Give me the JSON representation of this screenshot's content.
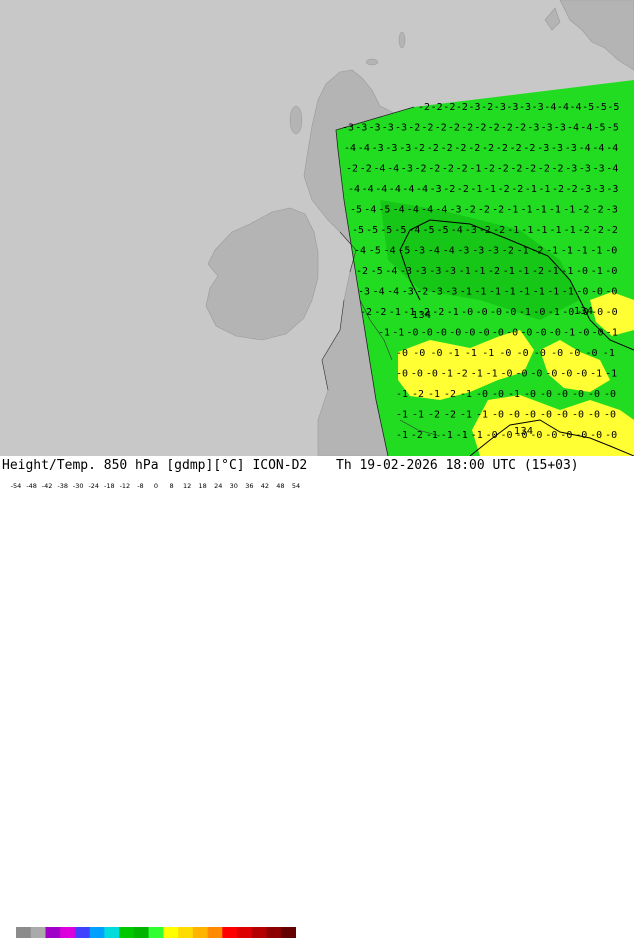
{
  "footer": {
    "product": "Height/Temp. 850 hPa [gdmp][°C] ICON-D2",
    "datetime": "Th 19-02-2026 18:00 UTC (15+03)"
  },
  "legend": {
    "ticks": [
      "-54",
      "-48",
      "-42",
      "-38",
      "-30",
      "-24",
      "-18",
      "-12",
      "-8",
      "0",
      "8",
      "12",
      "18",
      "24",
      "30",
      "36",
      "42",
      "48",
      "54"
    ],
    "colors": [
      "#8c8c8c",
      "#aaaaaa",
      "#a000c8",
      "#dc00dc",
      "#4040ff",
      "#00a0ff",
      "#00dcdc",
      "#00c800",
      "#00b400",
      "#32ff32",
      "#ffff00",
      "#ffdc00",
      "#ffb400",
      "#ff8c00",
      "#ff0000",
      "#dc0000",
      "#b40000",
      "#8c0000",
      "#640000"
    ]
  },
  "map": {
    "colors": {
      "sea": "#c8c8c8",
      "land": "#b4b4b4",
      "green": "#22dc22",
      "green_dark": "#17c717",
      "yellow": "#ffff33"
    },
    "height_labels": [
      "134",
      "134",
      "134"
    ],
    "temp_rows": [
      "2 2 2 2 3 2 3 3 3 3 4 4 4 5 5 5",
      "3 3 3 3 3 2 2 2 2 2 2 2 2 2 3 3 3 4 4 5 5",
      "4 4 3 3 3 2 2 2 2 2 2 2 2 2 3 3 3 4 4 4",
      "2 2 4 4 3 2 2 2 2 1 2 2 2 2 2 2 3 3 3 4",
      "4 4 4 4 4 4 3 2 2 1 1 2 2 1 1 2 2 3 3 3",
      "5 4 5 4 4 4 4 3 2 2 2 1 1 1 1 1 2 2 3",
      "5 5 5 5 4 5 5 4 3 2 2 1 1 1 1 1 2 2 2",
      "4 5 4 5 3 4 4 3 3 3 2 1 2 1 1 1 1 0",
      "2 5 4 3 3 3 3 1 1 2 1 1 2 1 1 0 1 0",
      "3 4 4 3 2 3 3 1 1 1 1 1 1 1 1 0 0 0",
      "2 2 1 1 2 2 1 0 0 0 0 1 0 1 0 0 0 0",
      "1 1 0 0 0 0 0 0 0 0 0 0 0 1 0 0 1",
      "0 0 0 1 1 1 0 0 0 0 0 0 1",
      "0 0 0 1 2 1 1 0 0 0 0 0 0 1 1",
      "1 2 1 2 1 0 0 1 0 0 0 0 0 0",
      "1 1 2 2 1 1 0 0 0 0 0 0 0 0",
      "1 2 1 1 1 1 0 0 0 0 0 0 0 0 0"
    ]
  }
}
